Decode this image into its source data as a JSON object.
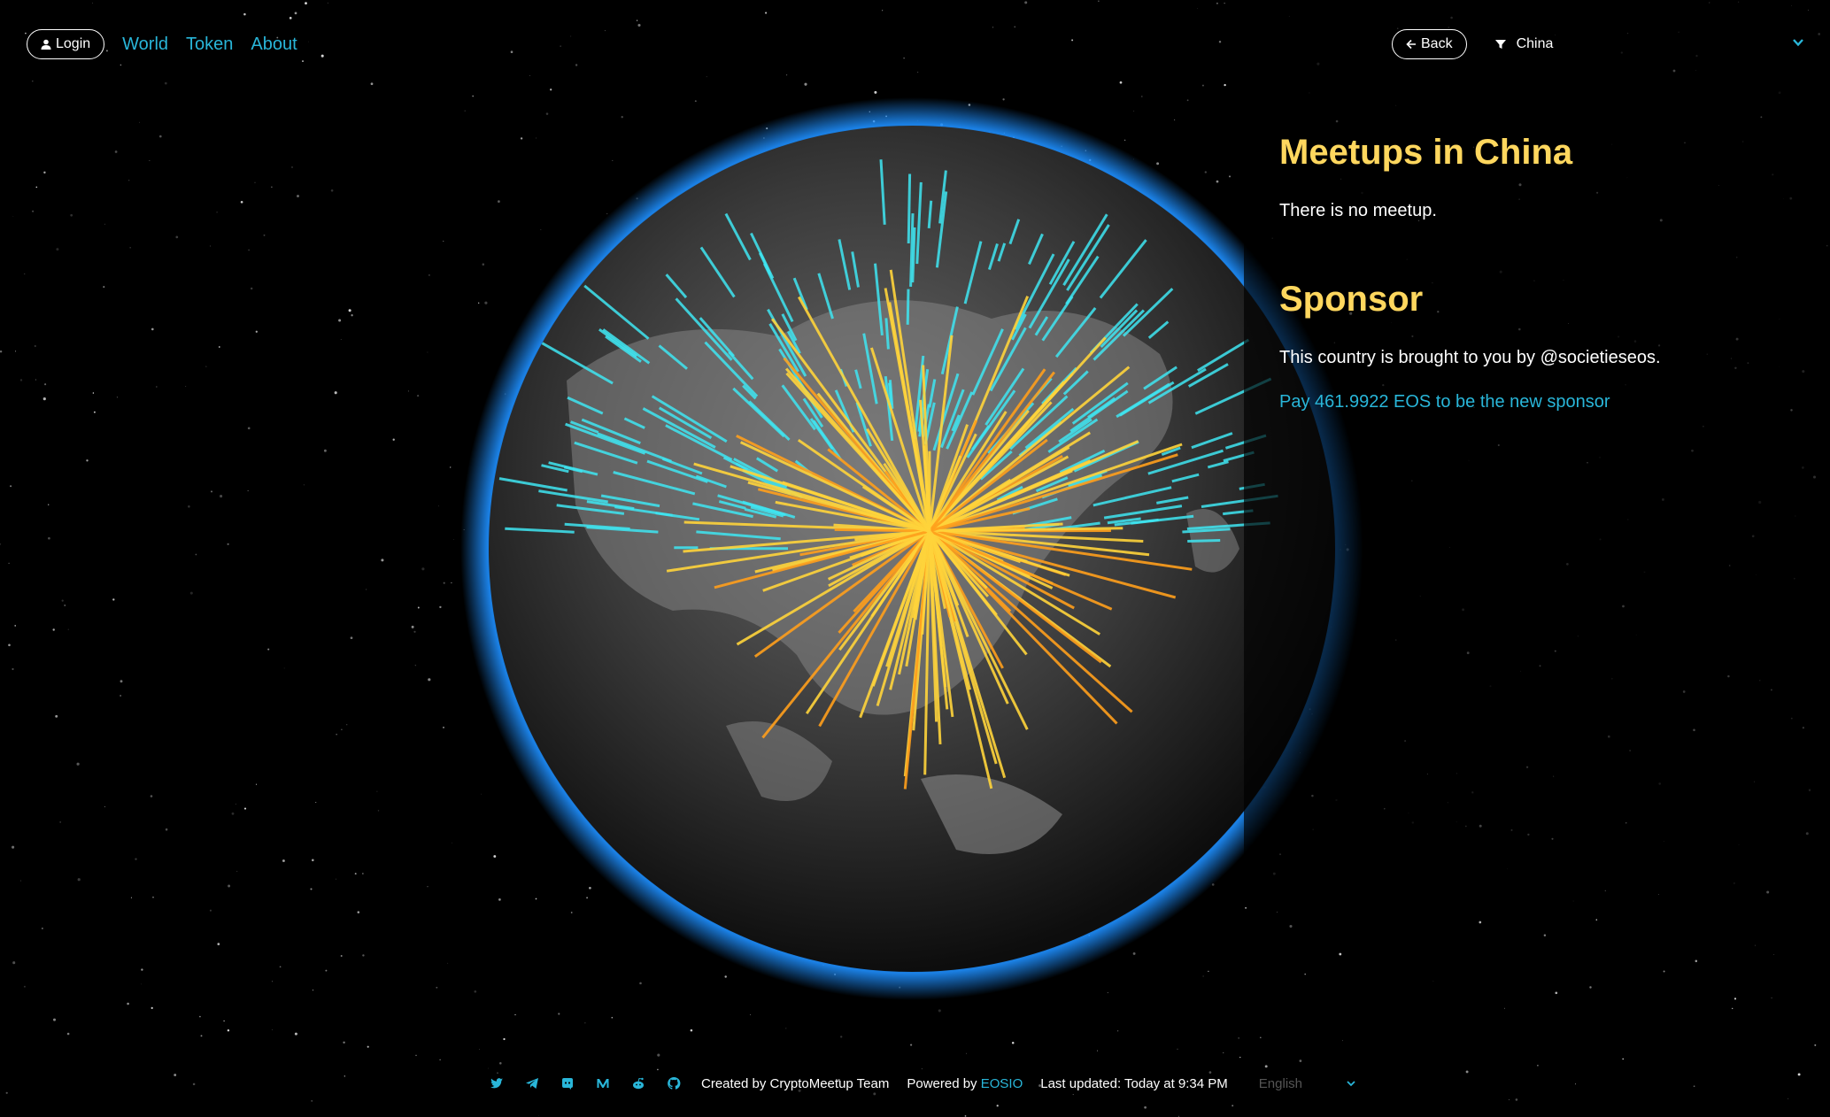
{
  "nav": {
    "login_label": "Login",
    "links": [
      "World",
      "Token",
      "About"
    ]
  },
  "panel": {
    "back_label": "Back",
    "selected_country": "China",
    "meetups_prefix": "Meetups in",
    "meetups_country": "China",
    "no_meetup_text": "There is no meetup.",
    "sponsor_heading": "Sponsor",
    "sponsor_text": "This country is brought to you by @societieseos.",
    "sponsor_link": "Pay 461.9922 EOS to be the new sponsor"
  },
  "footer": {
    "icons": [
      "twitter-icon",
      "telegram-icon",
      "discord-icon",
      "medium-icon",
      "reddit-icon",
      "github-icon"
    ],
    "created_by": "Created by CryptoMeetup Team",
    "powered_prefix": "Powered by",
    "powered_link": "EOSIO",
    "last_updated": "Last updated: Today at 9:34 PM",
    "language": "English"
  },
  "colors": {
    "accent": "#29b6d9",
    "title": "#ffd75e",
    "bar_yellow": "#ffd43b",
    "bar_cyan": "#3fe6f2",
    "atmosphere": "#1e8fff"
  }
}
